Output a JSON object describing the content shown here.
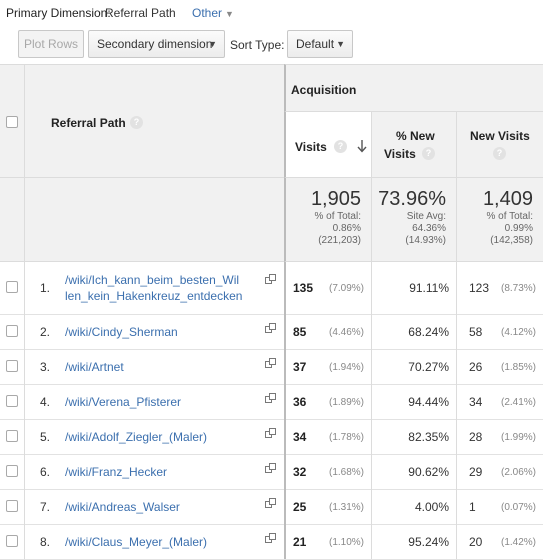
{
  "top_bar": {
    "primary_dimension_label": "Primary Dimension:",
    "primary_dimension_value": "Referral Path",
    "other_label": "Other"
  },
  "toolbar": {
    "plot_rows": "Plot Rows",
    "secondary_dimension": "Secondary dimension",
    "sort_type_label": "Sort Type:",
    "sort_type_value": "Default"
  },
  "table": {
    "group_header": "Acquisition",
    "col_dimension": "Referral Path",
    "col_visits": "Visits",
    "col_new_pct_line1": "% New",
    "col_new_pct_line2": "Visits",
    "col_new_visits": "New Visits",
    "totals": {
      "visits": "1,905",
      "visits_pct_label": "% of Total:",
      "visits_pct": "0.86%",
      "visits_total": "(221,203)",
      "new_pct": "73.96%",
      "new_pct_label": "Site Avg:",
      "new_pct_avg": "64.36%",
      "new_pct_diff": "(14.93%)",
      "new_visits": "1,409",
      "new_visits_pct_label": "% of Total:",
      "new_visits_pct": "0.99%",
      "new_visits_total": "(142,358)"
    },
    "rows": [
      {
        "index": "1.",
        "path_line1": "/wiki/Ich_kann_beim_besten_Wil",
        "path_line2": "len_kein_Hakenkreuz_entdecken",
        "visits": "135",
        "visits_pct": "(7.09%)",
        "new_pct": "91.11%",
        "new_visits": "123",
        "new_visits_pct": "(8.73%)"
      },
      {
        "index": "2.",
        "path_line1": "/wiki/Cindy_Sherman",
        "path_line2": "",
        "visits": "85",
        "visits_pct": "(4.46%)",
        "new_pct": "68.24%",
        "new_visits": "58",
        "new_visits_pct": "(4.12%)"
      },
      {
        "index": "3.",
        "path_line1": "/wiki/Artnet",
        "path_line2": "",
        "visits": "37",
        "visits_pct": "(1.94%)",
        "new_pct": "70.27%",
        "new_visits": "26",
        "new_visits_pct": "(1.85%)"
      },
      {
        "index": "4.",
        "path_line1": "/wiki/Verena_Pfisterer",
        "path_line2": "",
        "visits": "36",
        "visits_pct": "(1.89%)",
        "new_pct": "94.44%",
        "new_visits": "34",
        "new_visits_pct": "(2.41%)"
      },
      {
        "index": "5.",
        "path_line1": "/wiki/Adolf_Ziegler_(Maler)",
        "path_line2": "",
        "visits": "34",
        "visits_pct": "(1.78%)",
        "new_pct": "82.35%",
        "new_visits": "28",
        "new_visits_pct": "(1.99%)"
      },
      {
        "index": "6.",
        "path_line1": "/wiki/Franz_Hecker",
        "path_line2": "",
        "visits": "32",
        "visits_pct": "(1.68%)",
        "new_pct": "90.62%",
        "new_visits": "29",
        "new_visits_pct": "(2.06%)"
      },
      {
        "index": "7.",
        "path_line1": "/wiki/Andreas_Walser",
        "path_line2": "",
        "visits": "25",
        "visits_pct": "(1.31%)",
        "new_pct": "4.00%",
        "new_visits": "1",
        "new_visits_pct": "(0.07%)"
      },
      {
        "index": "8.",
        "path_line1": "/wiki/Claus_Meyer_(Maler)",
        "path_line2": "",
        "visits": "21",
        "visits_pct": "(1.10%)",
        "new_pct": "95.24%",
        "new_visits": "20",
        "new_visits_pct": "(1.42%)"
      }
    ]
  },
  "colors": {
    "link": "#3b6fae",
    "header_bg": "#f1f1f1"
  }
}
